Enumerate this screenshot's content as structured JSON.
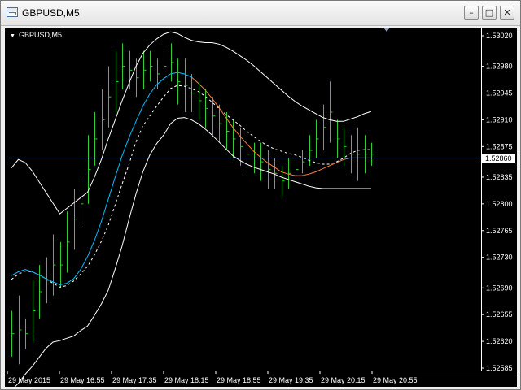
{
  "window": {
    "title": "GBPUSD,M5",
    "minimize_glyph": "–",
    "maximize_glyph": "□",
    "close_glyph": "✕",
    "icon": "chart-window-icon"
  },
  "chart": {
    "label": "GBPUSD,M5",
    "label_marker": "▼",
    "background": "#000000",
    "bar_color": "#32cd32",
    "current_price": "1.52860",
    "price_ticks": [
      "1.53020",
      "1.52980",
      "1.52945",
      "1.52910",
      "1.52875",
      "1.52835",
      "1.52800",
      "1.52765",
      "1.52730",
      "1.52690",
      "1.52655",
      "1.52620",
      "1.52585"
    ],
    "time_ticks": [
      "29 May 2015",
      "29 May 16:55",
      "29 May 17:35",
      "29 May 18:15",
      "29 May 18:55",
      "29 May 19:35",
      "29 May 20:15",
      "29 May 20:55"
    ]
  },
  "chart_data": {
    "type": "line",
    "symbol": "GBPUSD",
    "timeframe": "M5",
    "ylim": [
      1.52585,
      1.5302
    ],
    "last_price": 1.5286,
    "series": [
      {
        "color": "#ffffff",
        "values": [
          1.52847,
          1.52858,
          1.52854,
          1.52843,
          1.52829,
          1.52815,
          1.52801,
          1.52787,
          1.52794,
          1.52801,
          1.52808,
          1.52815,
          1.52835,
          1.52858,
          1.52885,
          1.5291,
          1.52935,
          1.52958,
          1.5298,
          1.52997,
          1.53008,
          1.53016,
          1.53022,
          1.53025,
          1.53023,
          1.53018,
          1.53014,
          1.53012,
          1.53011,
          1.53011,
          1.53009,
          1.53005,
          1.53,
          1.52994,
          1.52988,
          1.52981,
          1.52973,
          1.52965,
          1.52957,
          1.52949,
          1.52941,
          1.52934,
          1.52928,
          1.52923,
          1.52918,
          1.52913,
          1.5291,
          1.52908,
          1.52908,
          1.52911,
          1.52914,
          1.52918,
          1.52921
        ]
      },
      {
        "color": "#ffffff",
        "style": "dashed",
        "values": [
          1.52701,
          1.52708,
          1.52712,
          1.52711,
          1.52707,
          1.52702,
          1.52696,
          1.52691,
          1.52693,
          1.52699,
          1.52708,
          1.52718,
          1.52733,
          1.52751,
          1.52772,
          1.52799,
          1.52826,
          1.52852,
          1.52881,
          1.52902,
          1.52915,
          1.52928,
          1.5294,
          1.52951,
          1.52955,
          1.52954,
          1.52951,
          1.52947,
          1.52941,
          1.52933,
          1.52925,
          1.52917,
          1.5291,
          1.52903,
          1.52895,
          1.52888,
          1.52882,
          1.52876,
          1.52872,
          1.52869,
          1.52866,
          1.52864,
          1.52861,
          1.52857,
          1.52854,
          1.52852,
          1.52852,
          1.52855,
          1.5286,
          1.52866,
          1.5287,
          1.52871,
          1.52871
        ]
      },
      {
        "color": "#ffffff",
        "values": [
          1.52556,
          1.52565,
          1.52577,
          1.52587,
          1.52599,
          1.52611,
          1.52619,
          1.52621,
          1.52624,
          1.52627,
          1.52634,
          1.5264,
          1.52654,
          1.52669,
          1.52687,
          1.52715,
          1.52745,
          1.5278,
          1.52813,
          1.52842,
          1.52864,
          1.52879,
          1.5289,
          1.52905,
          1.52912,
          1.52913,
          1.5291,
          1.52905,
          1.52898,
          1.5289,
          1.52881,
          1.52872,
          1.52863,
          1.52857,
          1.52852,
          1.52848,
          1.52845,
          1.52842,
          1.52839,
          1.52835,
          1.52832,
          1.52829,
          1.52826,
          1.52823,
          1.52821,
          1.5282,
          1.5282,
          1.5282,
          1.5282,
          1.5282,
          1.5282,
          1.5282,
          1.5282
        ]
      },
      {
        "color": "#00bfff",
        "x_range": [
          0,
          26
        ],
        "values": [
          1.52706,
          1.52711,
          1.52714,
          1.52711,
          1.52707,
          1.52702,
          1.52698,
          1.52694,
          1.52696,
          1.52702,
          1.52714,
          1.52731,
          1.52752,
          1.52777,
          1.52806,
          1.52835,
          1.52863,
          1.52887,
          1.52908,
          1.52928,
          1.52944,
          1.52956,
          1.52964,
          1.5297,
          1.52972,
          1.5297,
          1.52966
        ]
      },
      {
        "color": "#ff7f3f",
        "x_range": [
          26,
          52
        ],
        "values": [
          1.52966,
          1.52958,
          1.52949,
          1.52938,
          1.52926,
          1.52913,
          1.529,
          1.52889,
          1.52879,
          1.52869,
          1.52861,
          1.52854,
          1.52848,
          1.52842,
          1.52839,
          1.52837,
          1.52837,
          1.52839,
          1.52842,
          1.52846,
          1.5285,
          1.52854,
          1.52858,
          1.5286,
          1.5286,
          1.5286,
          1.5286
        ]
      }
    ],
    "bars_hl": [
      [
        1.5266,
        1.526
      ],
      [
        1.5268,
        1.5259
      ],
      [
        1.5265,
        1.5261
      ],
      [
        1.527,
        1.5262
      ],
      [
        1.5272,
        1.5265
      ],
      [
        1.5273,
        1.5267
      ],
      [
        1.5276,
        1.5268
      ],
      [
        1.5275,
        1.5269
      ],
      [
        1.5279,
        1.5271
      ],
      [
        1.5282,
        1.5274
      ],
      [
        1.5283,
        1.5277
      ],
      [
        1.5289,
        1.528
      ],
      [
        1.5292,
        1.5285
      ],
      [
        1.5295,
        1.5287
      ],
      [
        1.5298,
        1.529
      ],
      [
        1.53,
        1.5292
      ],
      [
        1.5301,
        1.5295
      ],
      [
        1.53,
        1.5295
      ],
      [
        1.5299,
        1.5294
      ],
      [
        1.53,
        1.5295
      ],
      [
        1.53,
        1.5296
      ],
      [
        1.5299,
        1.5295
      ],
      [
        1.53,
        1.5296
      ],
      [
        1.5301,
        1.5296
      ],
      [
        1.5299,
        1.5293
      ],
      [
        1.5299,
        1.5292
      ],
      [
        1.5297,
        1.5292
      ],
      [
        1.5296,
        1.5291
      ],
      [
        1.5295,
        1.529
      ],
      [
        1.5294,
        1.5289
      ],
      [
        1.5293,
        1.5288
      ],
      [
        1.5292,
        1.5287
      ],
      [
        1.5291,
        1.5286
      ],
      [
        1.529,
        1.5285
      ],
      [
        1.5289,
        1.5284
      ],
      [
        1.5288,
        1.5284
      ],
      [
        1.5288,
        1.5283
      ],
      [
        1.5287,
        1.5282
      ],
      [
        1.5286,
        1.5282
      ],
      [
        1.5285,
        1.5281
      ],
      [
        1.5286,
        1.5282
      ],
      [
        1.5286,
        1.5283
      ],
      [
        1.5287,
        1.5284
      ],
      [
        1.5289,
        1.5285
      ],
      [
        1.5291,
        1.5286
      ],
      [
        1.5293,
        1.5287
      ],
      [
        1.5296,
        1.5288
      ],
      [
        1.5291,
        1.5286
      ],
      [
        1.529,
        1.5285
      ],
      [
        1.5289,
        1.5284
      ],
      [
        1.529,
        1.5283
      ],
      [
        1.5289,
        1.5284
      ],
      [
        1.5288,
        1.5285
      ]
    ]
  }
}
